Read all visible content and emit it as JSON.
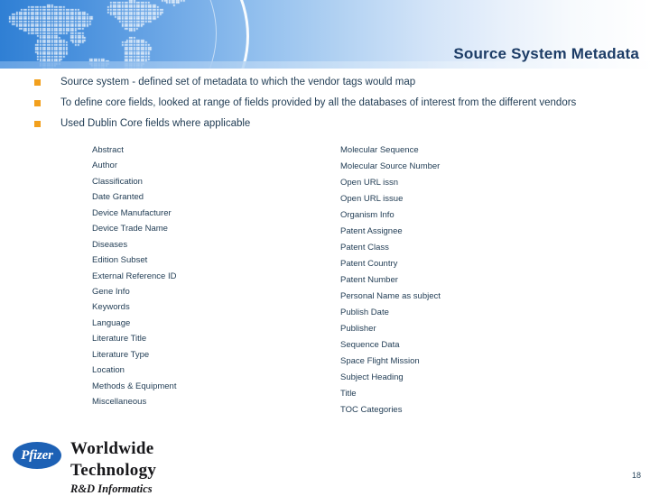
{
  "slide": {
    "title": "Source System Metadata",
    "page_number": "18",
    "accent_blue": "#1d61b5",
    "bullet_orange": "#f2a01d",
    "text_navy": "#1f3b53"
  },
  "bullets": [
    {
      "marker": "orange-square-bullet",
      "text": "Source system - defined set of metadata to which the vendor tags would map"
    },
    {
      "marker": "orange-square-bullet",
      "text": "To define core fields, looked at range of fields provided by all the databases of interest from the different vendors"
    },
    {
      "marker": "orange-square-bullet",
      "text": "Used Dublin Core fields where applicable"
    }
  ],
  "fields": {
    "left_column": [
      "Abstract",
      "Author",
      "Classification",
      "Date Granted",
      "Device Manufacturer",
      "Device Trade Name",
      "Diseases",
      "Edition Subset",
      "External Reference ID",
      "Gene Info",
      "Keywords",
      "Language",
      "Literature Title",
      "Literature Type",
      "Location",
      "Methods & Equipment",
      "Miscellaneous"
    ],
    "right_column": [
      "Molecular Sequence",
      "Molecular Source Number",
      "Open URL issn",
      "Open URL issue",
      "Organism Info",
      "Patent Assignee",
      "Patent Class",
      "Patent Country",
      "Patent Number",
      "Personal Name as subject",
      "Publish Date",
      "Publisher",
      "Sequence Data",
      "Space Flight Mission",
      "Subject Heading",
      "Title",
      "TOC Categories"
    ]
  },
  "footer": {
    "logo_text": "Pfizer",
    "line1": "Worldwide Technology",
    "line2": "R&D Informatics"
  }
}
